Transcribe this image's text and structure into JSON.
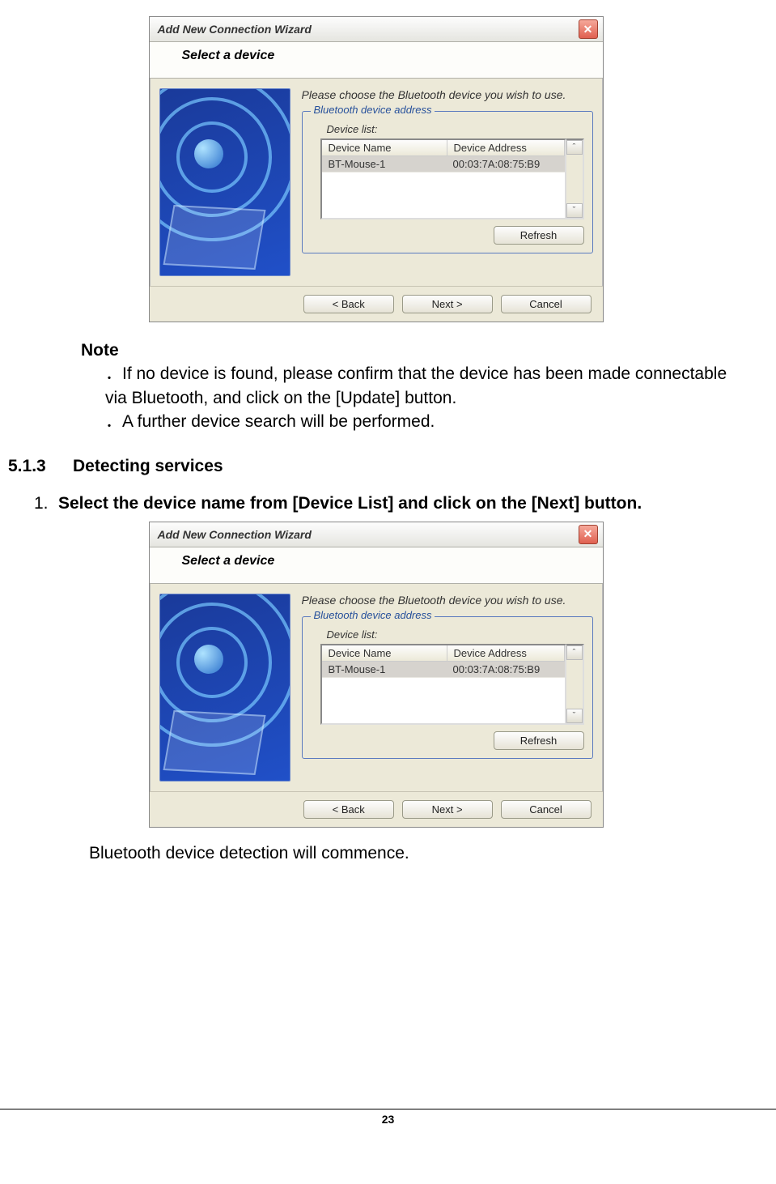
{
  "dialog": {
    "title": "Add New Connection Wizard",
    "subtitle": "Select a device",
    "instruction": "Please choose the Bluetooth device you wish to use.",
    "group_label": "Bluetooth device address",
    "list_label": "Device list:",
    "columns": {
      "name": "Device Name",
      "address": "Device Address"
    },
    "row": {
      "name": "BT-Mouse-1",
      "address": "00:03:7A:08:75:B9"
    },
    "buttons": {
      "refresh": "Refresh",
      "back": "< Back",
      "next": "Next >",
      "cancel": "Cancel"
    },
    "close_glyph": "✕",
    "scroll_up": "ˆ",
    "scroll_down": "ˇ"
  },
  "note": {
    "heading": "Note",
    "item1": "．If no device is found, please confirm that the device has been made connectable via Bluetooth, and click on the [Update] button.",
    "item2": "．A further device search will be performed."
  },
  "section": {
    "number": "5.1.3",
    "title": "Detecting services"
  },
  "step": {
    "number": "1.",
    "text": "Select the device name from [Device List] and click on the [Next] button."
  },
  "tail": "Bluetooth device detection will commence.",
  "page_number": "23"
}
